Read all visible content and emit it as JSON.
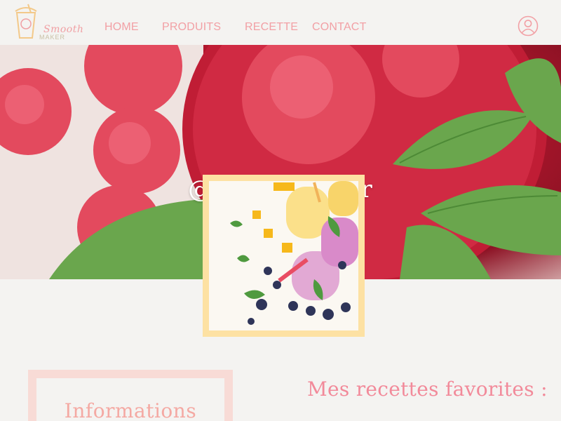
{
  "brand": {
    "logo_word": "Smooth",
    "logo_sub": "MAKER",
    "accent": "#f2a0a5",
    "background": "#f4f3f1"
  },
  "nav": {
    "home": "HOME",
    "produits": "PRODUITS",
    "recette": "RECETTE",
    "contact": "CONTACT"
  },
  "icons": {
    "logo": "smoothie-cup-icon",
    "account": "user-account-icon"
  },
  "profile": {
    "username": "@Pseudo-User",
    "frame_color": "#fde1a3"
  },
  "sections": {
    "informations": "Informations",
    "favorites": "Mes recettes favorites :"
  }
}
